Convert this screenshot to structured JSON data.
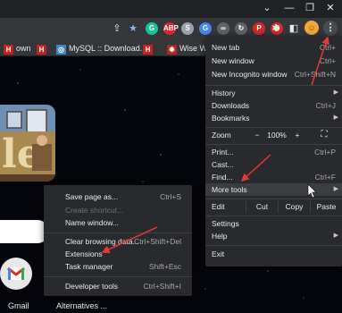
{
  "toolbar": {
    "extensions": [
      {
        "icon": "grammarly-icon",
        "text": "G",
        "color": "#15c39a"
      },
      {
        "icon": "adblock-icon",
        "text": "ABP",
        "color": "#e6202d"
      },
      {
        "icon": "s-extension-icon",
        "text": "S",
        "color": "#9aa0a6"
      },
      {
        "icon": "translate-icon",
        "text": "G",
        "color": "#4285f4"
      },
      {
        "icon": "link-icon",
        "text": "∞",
        "color": "#5f6368"
      },
      {
        "icon": "sync-icon",
        "text": "↻",
        "color": "#5f6368"
      },
      {
        "icon": "pin-icon",
        "text": "P",
        "color": "#d62828"
      },
      {
        "icon": "shield-icon",
        "text": "⬣",
        "color": "#d62828"
      }
    ]
  },
  "bookmarks": [
    {
      "label": "own"
    },
    {
      "label": "MySQL :: Download..."
    },
    {
      "label": "Wise Words"
    }
  ],
  "main_menu": {
    "new_tab": {
      "label": "New tab",
      "shortcut": "Ctrl+"
    },
    "new_window": {
      "label": "New window",
      "shortcut": "Ctrl+"
    },
    "new_incognito": {
      "label": "New Incognito window",
      "shortcut": "Ctrl+Shift+N"
    },
    "history": {
      "label": "History"
    },
    "downloads": {
      "label": "Downloads",
      "shortcut": "Ctrl+J"
    },
    "bookmarks": {
      "label": "Bookmarks"
    },
    "zoom": {
      "label": "Zoom",
      "minus": "−",
      "value": "100%",
      "plus": "+"
    },
    "print": {
      "label": "Print...",
      "shortcut": "Ctrl+P"
    },
    "cast": {
      "label": "Cast..."
    },
    "find": {
      "label": "Find...",
      "shortcut": "Ctrl+F"
    },
    "more_tools": {
      "label": "More tools"
    },
    "edit": {
      "label": "Edit",
      "cut": "Cut",
      "copy": "Copy",
      "paste": "Paste"
    },
    "settings": {
      "label": "Settings"
    },
    "help": {
      "label": "Help"
    },
    "exit": {
      "label": "Exit"
    }
  },
  "sub_menu": {
    "save_page": {
      "label": "Save page as...",
      "shortcut": "Ctrl+S"
    },
    "create_shortcut": {
      "label": "Create shortcut..."
    },
    "name_window": {
      "label": "Name window..."
    },
    "clear_browsing": {
      "label": "Clear browsing data...",
      "shortcut": "Ctrl+Shift+Del"
    },
    "extensions": {
      "label": "Extensions"
    },
    "task_manager": {
      "label": "Task manager",
      "shortcut": "Shift+Esc"
    },
    "developer_tools": {
      "label": "Developer tools",
      "shortcut": "Ctrl+Shift+I"
    }
  },
  "shortcuts": [
    {
      "label": "Gmail"
    },
    {
      "label": "Alternatives ..."
    }
  ],
  "colors": {
    "annotation": "#e53935",
    "menu_bg": "#292a2d"
  }
}
